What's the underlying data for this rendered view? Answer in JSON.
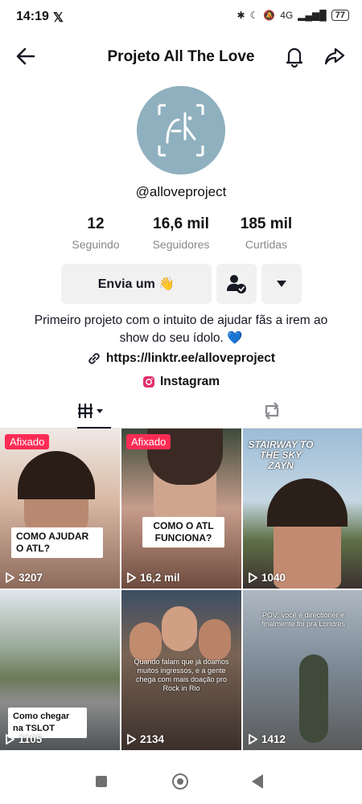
{
  "status_bar": {
    "time": "14:19",
    "x_glyph": "𝕏",
    "signal": "4G",
    "battery": "77"
  },
  "header": {
    "title": "Projeto All The Love"
  },
  "profile": {
    "handle": "@alloveproject",
    "stats": [
      {
        "value": "12",
        "label": "Seguindo"
      },
      {
        "value": "16,6 mil",
        "label": "Seguidores"
      },
      {
        "value": "185 mil",
        "label": "Curtidas"
      }
    ],
    "message_button": "Envia um 👋",
    "bio": "Primeiro projeto com o intuito de ajudar fãs a irem ao show do seu ídolo. 💙",
    "link": "https://linktr.ee/alloveproject",
    "instagram": "Instagram"
  },
  "videos": [
    {
      "pinned": "Afixado",
      "caption": "COMO AJUDAR O ATL?",
      "views": "3207",
      "bg": "#d9b9a4"
    },
    {
      "pinned": "Afixado",
      "caption": "COMO O ATL FUNCIONA?",
      "views": "16,2 mil",
      "bg": "#c79d8c"
    },
    {
      "overlay": "STAIRWAY TO THE SKY ZAYN",
      "views": "1040",
      "bg": "#9cbcd6"
    },
    {
      "caption": "Como chegar na TSLOT",
      "views": "1105",
      "bg": "#7e8a7c"
    },
    {
      "overlay": "Quando falam que já doamos muitos ingressos, e a gente chega com mais doação pro Rock in Rio",
      "views": "2134",
      "bg": "#5a5146"
    },
    {
      "overlay": "POV: você é directioner e finalmente foi pra Londres",
      "views": "1412",
      "bg": "#7f8c99"
    }
  ]
}
